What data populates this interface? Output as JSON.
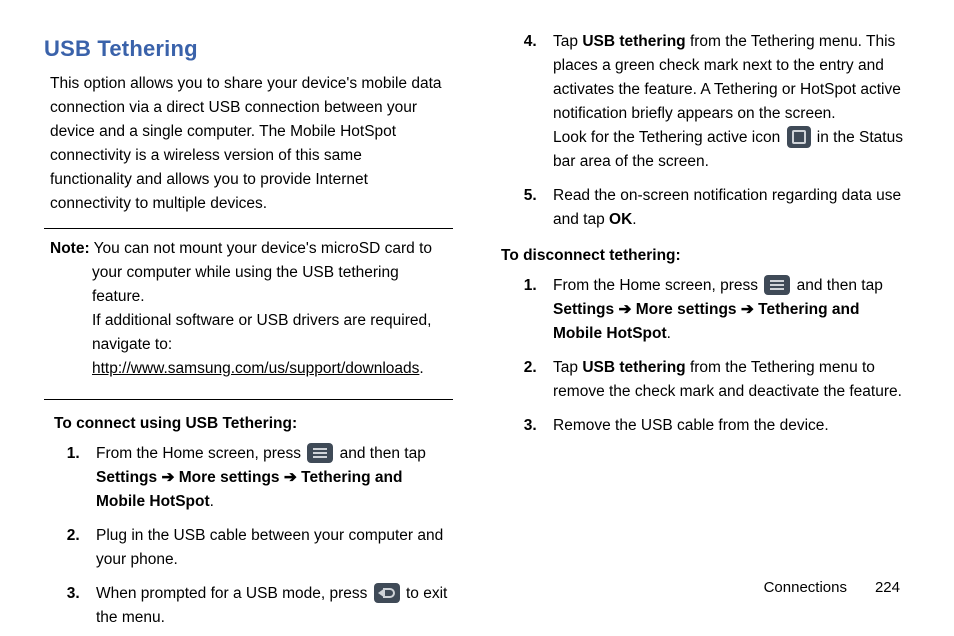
{
  "heading": "USB Tethering",
  "intro": "This option allows you to share your device's mobile data connection via a direct USB connection between your device and a single computer. The Mobile HotSpot connectivity is a wireless version of this same functionality and allows you to provide Internet connectivity to multiple devices.",
  "note": {
    "label": "Note:",
    "text1": " You can not mount your device's microSD card to your computer while using the USB tethering feature.",
    "text2": "If additional software or USB drivers are required, navigate to: ",
    "link": "http://www.samsung.com/us/support/downloads",
    "period": "."
  },
  "connect_heading": "To connect using USB Tethering:",
  "connect_steps": {
    "s1_a": "From the Home screen, press ",
    "s1_b": " and then tap ",
    "s1_settings": "Settings",
    "s1_arrow": " ➔ ",
    "s1_more": "More settings",
    "s1_teth": "Tethering and Mobile HotSpot",
    "s1_end": ".",
    "s2": "Plug in the USB cable between your computer and your phone.",
    "s3_a": "When prompted for a USB mode, press ",
    "s3_b": " to exit the menu."
  },
  "right_steps": {
    "s4_a": "Tap ",
    "s4_usb": "USB tethering",
    "s4_b": " from the Tethering menu. This places a green check mark next to the entry and activates the feature. A Tethering or HotSpot active notification briefly appears on the screen.",
    "s4_c": "Look for the Tethering active icon ",
    "s4_d": " in the Status bar area of the screen.",
    "s5_a": "Read the on-screen notification regarding data use and tap ",
    "s5_ok": "OK",
    "s5_b": "."
  },
  "disconnect_heading": "To disconnect tethering:",
  "disconnect_steps": {
    "s1_a": "From the Home screen, press ",
    "s1_b": " and then tap ",
    "s1_settings": "Settings",
    "s1_arrow": " ➔ ",
    "s1_more": "More settings",
    "s1_teth": "Tethering and Mobile HotSpot",
    "s1_end": ".",
    "s2_a": "Tap ",
    "s2_usb": "USB tethering",
    "s2_b": " from the Tethering menu to remove the check mark and deactivate the feature.",
    "s3": "Remove the USB cable from the device."
  },
  "footer": {
    "section": "Connections",
    "page": "224"
  }
}
